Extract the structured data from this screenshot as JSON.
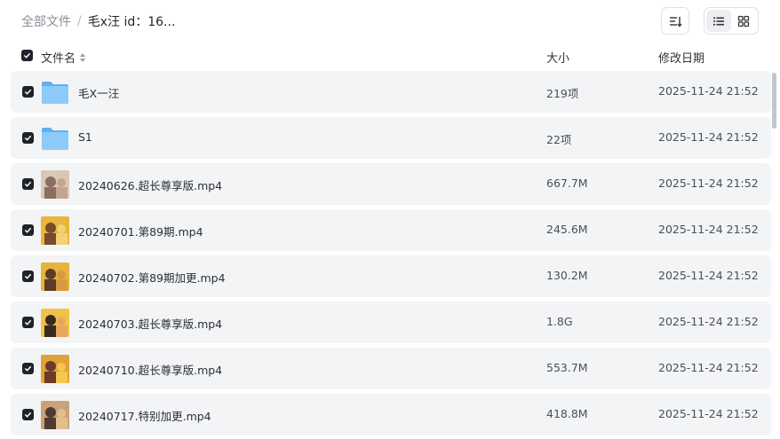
{
  "breadcrumb": {
    "root": "全部文件",
    "separator": "/",
    "current": "毛x汪 id：16..."
  },
  "toolbar": {
    "sort_icon": "sort-icon",
    "list_view_icon": "list-view-icon",
    "grid_view_icon": "grid-view-icon",
    "active_view": "list"
  },
  "columns": {
    "name": "文件名",
    "size": "大小",
    "modified": "修改日期"
  },
  "colors": {
    "row_bg": "#f3f4f5",
    "checkbox": "#1f2329",
    "folder": "#7cc2f7"
  },
  "files": [
    {
      "type": "folder",
      "name": "毛X一汪",
      "size": "219项",
      "modified": "2025-11-24 21:52",
      "checked": true
    },
    {
      "type": "folder",
      "name": "S1",
      "size": "22项",
      "modified": "2025-11-24 21:52",
      "checked": true
    },
    {
      "type": "video",
      "name": "20240626.超长尊享版.mp4",
      "size": "667.7M",
      "modified": "2025-11-24 21:52",
      "checked": true
    },
    {
      "type": "video",
      "name": "20240701.第89期.mp4",
      "size": "245.6M",
      "modified": "2025-11-24 21:52",
      "checked": true
    },
    {
      "type": "video",
      "name": "20240702.第89期加更.mp4",
      "size": "130.2M",
      "modified": "2025-11-24 21:52",
      "checked": true
    },
    {
      "type": "video",
      "name": "20240703.超长尊享版.mp4",
      "size": "1.8G",
      "modified": "2025-11-24 21:52",
      "checked": true
    },
    {
      "type": "video",
      "name": "20240710.超长尊享版.mp4",
      "size": "553.7M",
      "modified": "2025-11-24 21:52",
      "checked": true
    },
    {
      "type": "video",
      "name": "20240717.特别加更.mp4",
      "size": "418.8M",
      "modified": "2025-11-24 21:52",
      "checked": true
    }
  ]
}
